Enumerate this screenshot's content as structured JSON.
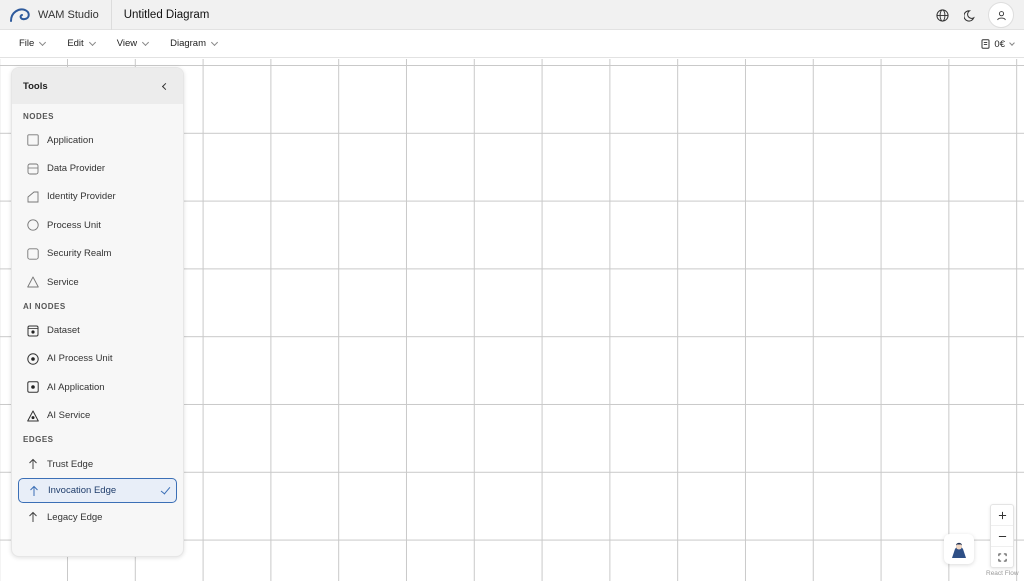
{
  "app": {
    "name": "WAM Studio",
    "document_title": "Untitled Diagram"
  },
  "header": {
    "icons": [
      "globe-icon",
      "moon-icon",
      "user-icon"
    ]
  },
  "menu": {
    "items": [
      {
        "label": "File"
      },
      {
        "label": "Edit"
      },
      {
        "label": "View"
      },
      {
        "label": "Diagram"
      }
    ],
    "cost": {
      "label": "0€",
      "icon": "cost-icon"
    }
  },
  "tools": {
    "title": "Tools",
    "sections": [
      {
        "title": "NODES",
        "items": [
          {
            "label": "Application",
            "icon": "application-icon"
          },
          {
            "label": "Data Provider",
            "icon": "database-icon"
          },
          {
            "label": "Identity Provider",
            "icon": "identity-provider-icon"
          },
          {
            "label": "Process Unit",
            "icon": "circle-icon"
          },
          {
            "label": "Security Realm",
            "icon": "square-icon"
          },
          {
            "label": "Service",
            "icon": "triangle-icon"
          }
        ]
      },
      {
        "title": "AI NODES",
        "items": [
          {
            "label": "Dataset",
            "icon": "ai-dataset-icon"
          },
          {
            "label": "AI Process Unit",
            "icon": "ai-circle-icon"
          },
          {
            "label": "AI Application",
            "icon": "ai-square-icon"
          },
          {
            "label": "AI Service",
            "icon": "ai-triangle-icon"
          }
        ]
      },
      {
        "title": "EDGES",
        "items": [
          {
            "label": "Trust Edge",
            "icon": "arrow-up-icon"
          },
          {
            "label": "Invocation Edge",
            "icon": "arrow-up-icon",
            "selected": true
          },
          {
            "label": "Legacy Edge",
            "icon": "arrow-up-icon"
          }
        ]
      }
    ]
  },
  "canvas": {
    "zoom_controls": [
      "zoom-in-icon",
      "zoom-out-icon",
      "fit-view-icon"
    ],
    "attribution": "React Flow"
  },
  "colors": {
    "accent": "#3b6fb6",
    "grid": "#c9c9c9",
    "header_bg": "#f1f1f1"
  }
}
